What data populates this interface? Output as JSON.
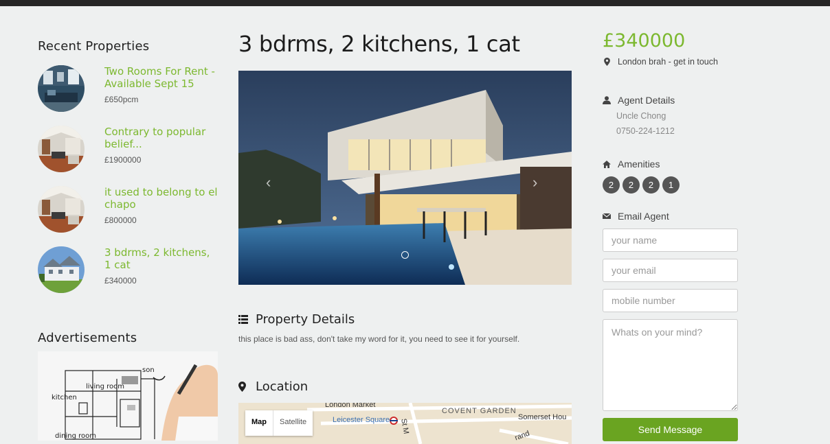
{
  "recent": {
    "title": "Recent Properties",
    "items": [
      {
        "title": "Two Rooms For Rent - Available Sept 15",
        "price": "£650pcm"
      },
      {
        "title": "Contrary to popular belief...",
        "price": "£1900000"
      },
      {
        "title": "it used to belong to el chapo",
        "price": "£800000"
      },
      {
        "title": "3 bdrms, 2 kitchens, 1 cat",
        "price": "£340000"
      }
    ]
  },
  "ads": {
    "title": "Advertisements",
    "image_labels": {
      "son": "son",
      "living": "living room",
      "kitchen": "kitchen",
      "dining": "dining room"
    }
  },
  "property": {
    "title": "3 bdrms, 2 kitchens, 1 cat",
    "details_heading": "Property Details",
    "details_text": "this place is bad ass, don't take my word for it, you need to see it for yourself.",
    "location_heading": "Location"
  },
  "carousel": {
    "prev": "‹",
    "next": "›"
  },
  "map": {
    "tabs": [
      "Map",
      "Satellite"
    ],
    "labels": {
      "london_market": "London Market",
      "leicester": "Leicester Square",
      "covent": "COVENT GARDEN",
      "st_martin": "St M",
      "somerset": "Somerset Hou",
      "strand": "rand"
    }
  },
  "sidebar": {
    "price": "£340000",
    "location": "London brah - get in touch",
    "agent_heading": "Agent Details",
    "agent_name": "Uncle Chong",
    "agent_phone": "0750-224-1212",
    "amenities_heading": "Amenities",
    "amenities": [
      "2",
      "2",
      "2",
      "1"
    ],
    "email_heading": "Email Agent",
    "placeholders": {
      "name": "your name",
      "email": "your email",
      "mobile": "mobile number",
      "message": "Whats on your mind?"
    },
    "send_label": "Send Message"
  },
  "colors": {
    "accent": "#7cb82f",
    "button": "#6aa421",
    "badge": "#555555"
  }
}
